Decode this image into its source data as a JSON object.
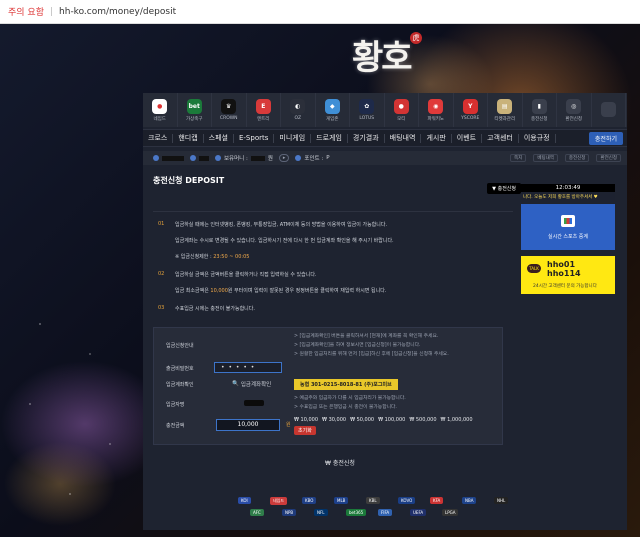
{
  "browser": {
    "warning": "주의 요함",
    "url": "hh-ko.com/money/deposit"
  },
  "logo": {
    "text": "황호",
    "seal": "虎"
  },
  "game_icons": [
    {
      "label": "네임드",
      "icon": "named-icon",
      "color": "#ffffff",
      "glyph": "●"
    },
    {
      "label": "가상축구",
      "icon": "bet365-icon",
      "color": "#1b7a3a",
      "glyph": "bet"
    },
    {
      "label": "CROWN",
      "icon": "crown-icon",
      "color": "#111111",
      "glyph": "♛"
    },
    {
      "label": "엔트리",
      "icon": "entry-icon",
      "color": "#d83a3a",
      "glyph": "E"
    },
    {
      "label": "OZ",
      "icon": "oz-icon",
      "color": "#2b2f3a",
      "glyph": "◐"
    },
    {
      "label": "게임존",
      "icon": "gamezone-icon",
      "color": "#3f8fd6",
      "glyph": "◆"
    },
    {
      "label": "LOTUS",
      "icon": "lotus-icon",
      "color": "#1e2a4a",
      "glyph": "✿"
    },
    {
      "label": "모티",
      "icon": "moti-icon",
      "color": "#d23434",
      "glyph": "●"
    },
    {
      "label": "파워키노",
      "icon": "powerkeno-icon",
      "color": "#e03a3a",
      "glyph": "◉"
    },
    {
      "label": "YSCORE",
      "icon": "yscore-icon",
      "color": "#d83030",
      "glyph": "Y"
    },
    {
      "label": "티켓과관리",
      "icon": "ticket-icon",
      "color": "#c9b27a",
      "glyph": "▤"
    },
    {
      "label": "충전신청",
      "icon": "charge-chart-icon",
      "color": "#3a3f4c",
      "glyph": "▮"
    },
    {
      "label": "환전신청",
      "icon": "exchange-icon",
      "color": "#3a3f4c",
      "glyph": "◎"
    },
    {
      "label": "",
      "icon": "extra-icon",
      "color": "#3a3f4c",
      "glyph": ""
    }
  ],
  "menu": [
    "크로스",
    "핸디캡",
    "스페셜",
    "E-Sports",
    "미니게임",
    "드로게임",
    "경기결과",
    "배팅내역",
    "게시판",
    "이벤트",
    "고객센터",
    "이용규정"
  ],
  "charge_button": "충전하기",
  "user": {
    "points_label": "보유머니 :",
    "points_unit": "원",
    "point_label": "포인트 :",
    "point_value": "P",
    "top_buttons": [
      "쪽지",
      "베팅내역",
      "충전신청",
      "환전신청"
    ]
  },
  "page_title": "충전신청 DEPOSIT",
  "history_button": "충전신청",
  "notes": [
    {
      "num": "01",
      "text": "입금하실 때에는 인터넷뱅킹, 폰뱅킹, 무통장입금, ATM이체 등의 방법을 이용하여 입금이 가능합니다."
    },
    {
      "num": "",
      "text": "입금계좌는 수시로 변경될 수 있습니다. 입금하시기 전에 다시 한 번 입금계좌 확인을 해 주시기 바랍니다."
    },
    {
      "num": "",
      "text": "※ 입금신청제한 : ",
      "highlight": "23:50 ~ 00:05"
    },
    {
      "num": "02",
      "text": "입금하실 금액은 금액버튼을 클릭하거나 직접 입력하실 수 있습니다."
    },
    {
      "num": "",
      "text": "입금 최소금액은 ",
      "highlight": "10,000",
      "rest": "원 부터이며 입력이 잘못된 경우 정정버튼을 클릭하여 재입력 하시면 됩니다."
    },
    {
      "num": "03",
      "text": "수표입금 시에는 충전이 불가능합니다."
    }
  ],
  "form": {
    "guide_label": "입금신청안내",
    "guide_lines": [
      "> [입금계좌확인] 버튼을 클릭하셔서 [현재]에 계좌를 꼭 확인해 주세요.",
      "> [입금계좌확인]을 하여 정보시면 [입금신청]이 불가능합니다.",
      "> 원활한 입금처리를 위해 먼저 [입금]하신 후에 [입금신청]을 신청해 주세요."
    ],
    "password_label": "출금비밀번호",
    "password_value": "• • • • •",
    "account_label": "입금계좌확인",
    "account_button": "입금계좌확인",
    "account_info": "농협 301-0215-8018-81 (주)포그미브",
    "depositor_label": "입금자명",
    "depositor_notes": [
      "> 예금주와 입금자가 다를 시 입금처리가 불가능합니다.",
      "> 수표입금 또는 은행입금 시 충전이 불가능합니다."
    ],
    "amount_label": "충전금액",
    "amount_value": "10,000",
    "amount_unit": "원",
    "amount_buttons": [
      "₩ 10,000",
      "₩ 30,000",
      "₩ 50,000",
      "₩ 100,000",
      "₩ 500,000",
      "₩ 1,000,000"
    ],
    "reset_button": "초기화"
  },
  "submit_label": "₩ 충전신청",
  "sidebar": {
    "clock": "12:03:49",
    "ticker": "나다. 오늘도 저희 황호를 방아주셔서 ♥",
    "sports_label": "실시간 스포츠 중계",
    "kakao_talk": "TALK",
    "kakao_ids": [
      "hho01",
      "hho114"
    ],
    "kakao_sub": "24시간 고객센터 문의 가능합니다"
  },
  "partners": [
    {
      "name": "KOI",
      "color": "#2a4da8"
    },
    {
      "name": "네임드",
      "color": "#cc3b3b"
    },
    {
      "name": "KBO",
      "color": "#1f3f86"
    },
    {
      "name": "MLB",
      "color": "#1c3f8a"
    },
    {
      "name": "KBL",
      "color": "#3c3c3c"
    },
    {
      "name": "KOVO",
      "color": "#1a3e86"
    },
    {
      "name": "KFA",
      "color": "#cc3333"
    },
    {
      "name": "NBA",
      "color": "#1d428a"
    },
    {
      "name": "NHL",
      "color": "#222222"
    },
    {
      "name": "AFC",
      "color": "#2f7d4a"
    },
    {
      "name": "NPB",
      "color": "#1e3a7a"
    },
    {
      "name": "NFL",
      "color": "#013369"
    },
    {
      "name": "bet365",
      "color": "#1b7a3a"
    },
    {
      "name": "FIFA",
      "color": "#3062b0"
    },
    {
      "name": "UEFA",
      "color": "#1f2f6a"
    },
    {
      "name": "LPGA",
      "color": "#333333"
    }
  ]
}
